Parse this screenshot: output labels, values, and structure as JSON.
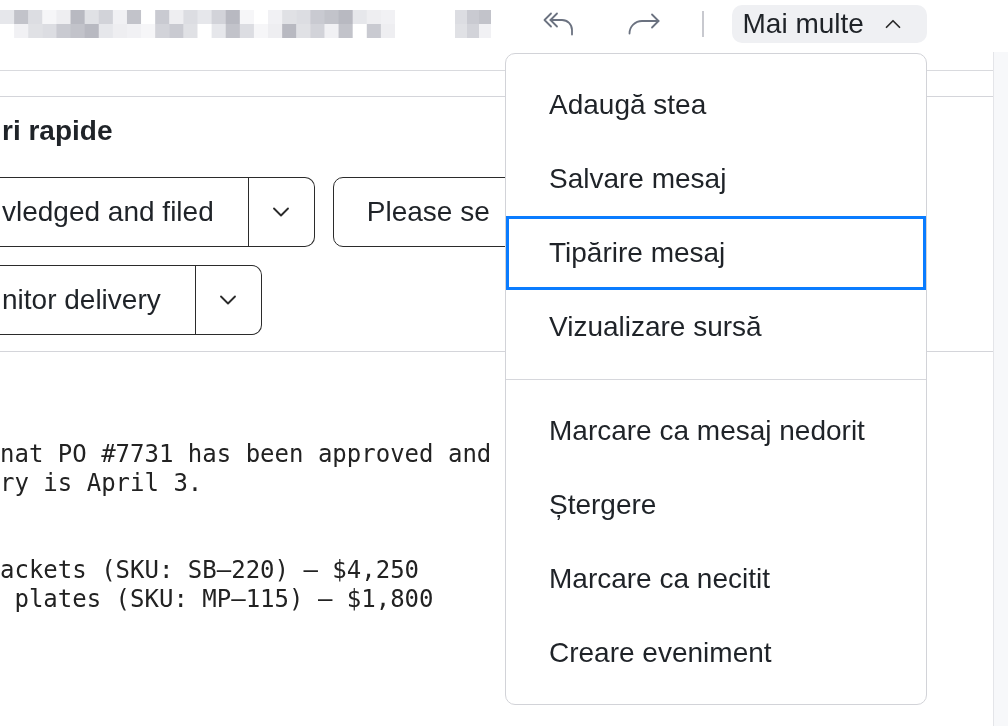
{
  "header": {
    "more_button": {
      "label": "Mai multe",
      "expanded": true
    }
  },
  "quick_replies": {
    "title": "ri rapide",
    "buttons": [
      {
        "label": "vledged and filed",
        "kind": "split"
      },
      {
        "label": "Please se",
        "kind": "plain"
      },
      {
        "label": "nitor delivery",
        "kind": "split"
      }
    ]
  },
  "body": {
    "paragraphs": [
      {
        "lines": [
          "nat PO #7731 has been approved and",
          "ry is April 3."
        ]
      },
      {
        "lines": [
          "ackets (SKU: SB–220) — $4,250",
          " plates (SKU: MP–115) — $1,800"
        ]
      }
    ]
  },
  "menu": {
    "sections": [
      {
        "items": [
          {
            "label": "Adaugă stea",
            "selected": false
          },
          {
            "label": "Salvare mesaj",
            "selected": false
          },
          {
            "label": "Tipărire mesaj",
            "selected": true
          },
          {
            "label": "Vizualizare sursă",
            "selected": false
          }
        ]
      },
      {
        "items": [
          {
            "label": "Marcare ca mesaj nedorit",
            "selected": false
          },
          {
            "label": "Ștergere",
            "selected": false
          },
          {
            "label": "Marcare ca necitit",
            "selected": false
          },
          {
            "label": "Creare eveniment",
            "selected": false
          }
        ]
      }
    ]
  }
}
